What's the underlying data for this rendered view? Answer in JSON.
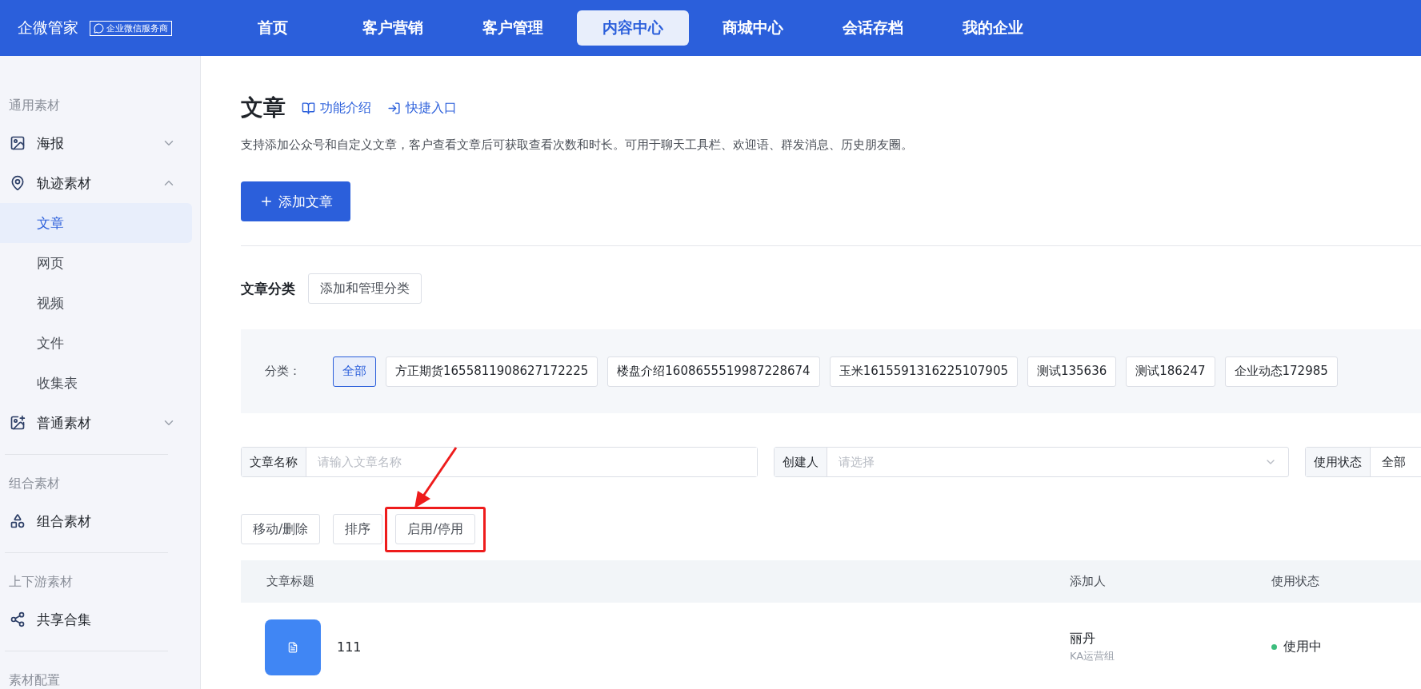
{
  "header": {
    "logo": "企微管家",
    "badge": "企业微信服务商",
    "nav": [
      {
        "label": "首页",
        "selected": false
      },
      {
        "label": "客户营销",
        "selected": false
      },
      {
        "label": "客户管理",
        "selected": false
      },
      {
        "label": "内容中心",
        "selected": true
      },
      {
        "label": "商城中心",
        "selected": false
      },
      {
        "label": "会话存档",
        "selected": false
      },
      {
        "label": "我的企业",
        "selected": false
      }
    ]
  },
  "sidebar": {
    "sections": [
      {
        "title": "通用素材",
        "items": [
          {
            "label": "海报",
            "kind": "image",
            "expanded": false
          },
          {
            "label": "轨迹素材",
            "kind": "pin",
            "expanded": true,
            "children": [
              {
                "label": "文章",
                "selected": true
              },
              {
                "label": "网页",
                "selected": false
              },
              {
                "label": "视频",
                "selected": false
              },
              {
                "label": "文件",
                "selected": false
              },
              {
                "label": "收集表",
                "selected": false
              }
            ]
          },
          {
            "label": "普通素材",
            "kind": "image-plus",
            "expanded": false
          }
        ]
      },
      {
        "title": "组合素材",
        "items": [
          {
            "label": "组合素材",
            "kind": "shapes"
          }
        ]
      },
      {
        "title": "上下游素材",
        "items": [
          {
            "label": "共享合集",
            "kind": "share"
          }
        ]
      },
      {
        "title": "素材配置"
      }
    ]
  },
  "page": {
    "title": "文章",
    "links": [
      {
        "label": "功能介绍",
        "kind": "book"
      },
      {
        "label": "快捷入口",
        "kind": "enter"
      }
    ],
    "description": "支持添加公众号和自定义文章，客户查看文章后可获取查看次数和时长。可用于聊天工具栏、欢迎语、群发消息、历史朋友圈。",
    "add_button": "添加文章",
    "category": {
      "label": "文章分类",
      "manage_button": "添加和管理分类",
      "filter_label": "分类：",
      "chips": [
        {
          "label": "全部",
          "selected": true
        },
        {
          "label": "方正期货1655811908627172225",
          "selected": false
        },
        {
          "label": "楼盘介绍1608655519987228674",
          "selected": false
        },
        {
          "label": "玉米1615591316225107905",
          "selected": false
        },
        {
          "label": "测试135636",
          "selected": false
        },
        {
          "label": "测试186247",
          "selected": false
        },
        {
          "label": "企业动态172985",
          "selected": false
        }
      ]
    },
    "filters": [
      {
        "label": "文章名称",
        "kind": "text",
        "placeholder": "请输入文章名称"
      },
      {
        "label": "创建人",
        "kind": "select",
        "placeholder": "请选择"
      },
      {
        "label": "使用状态",
        "kind": "value",
        "value": "全部"
      }
    ],
    "actions": [
      {
        "label": "移动/删除",
        "highlighted": false
      },
      {
        "label": "排序",
        "highlighted": false
      },
      {
        "label": "启用/停用",
        "highlighted": true
      }
    ],
    "table": {
      "columns": [
        "文章标题",
        "添加人",
        "使用状态"
      ],
      "rows": [
        {
          "title": "111",
          "adder": "丽丹",
          "team": "KA运营组",
          "status": "使用中",
          "color": "#3dbd7d"
        }
      ]
    }
  }
}
